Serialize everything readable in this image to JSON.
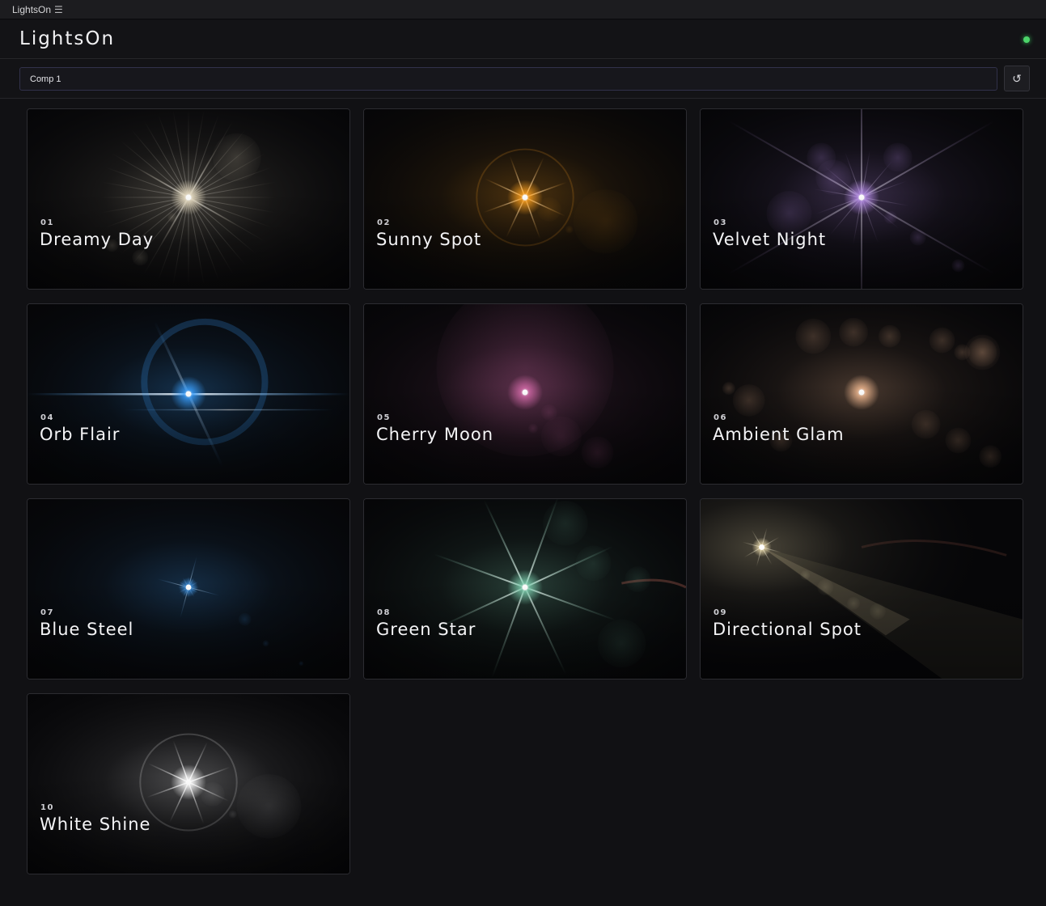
{
  "window": {
    "title": "LightsOn",
    "menu_icon": "hamburger-icon"
  },
  "header": {
    "app_title": "LightsOn",
    "status": {
      "color": "#4cd46a"
    }
  },
  "toolbar": {
    "composition": "Comp 1",
    "refresh_icon": "refresh-icon"
  },
  "presets": [
    {
      "number": "01",
      "name": "Dreamy Day",
      "color": "#e8dcc0",
      "style": "starburst"
    },
    {
      "number": "02",
      "name": "Sunny Spot",
      "color": "#ffa21f",
      "style": "star"
    },
    {
      "number": "03",
      "name": "Velvet Night",
      "color": "#b68ce8",
      "style": "bokeh-ray"
    },
    {
      "number": "04",
      "name": "Orb Flair",
      "color": "#3aa0ff",
      "style": "anamorphic"
    },
    {
      "number": "05",
      "name": "Cherry Moon",
      "color": "#d36aa8",
      "style": "glow"
    },
    {
      "number": "06",
      "name": "Ambient Glam",
      "color": "#f0b890",
      "style": "bokeh"
    },
    {
      "number": "07",
      "name": "Blue Steel",
      "color": "#3a90e0",
      "style": "small-star"
    },
    {
      "number": "08",
      "name": "Green Star",
      "color": "#7fd0b0",
      "style": "big-star"
    },
    {
      "number": "09",
      "name": "Directional Spot",
      "color": "#f0e0b0",
      "style": "beam"
    },
    {
      "number": "10",
      "name": "White Shine",
      "color": "#ffffff",
      "style": "star"
    }
  ]
}
